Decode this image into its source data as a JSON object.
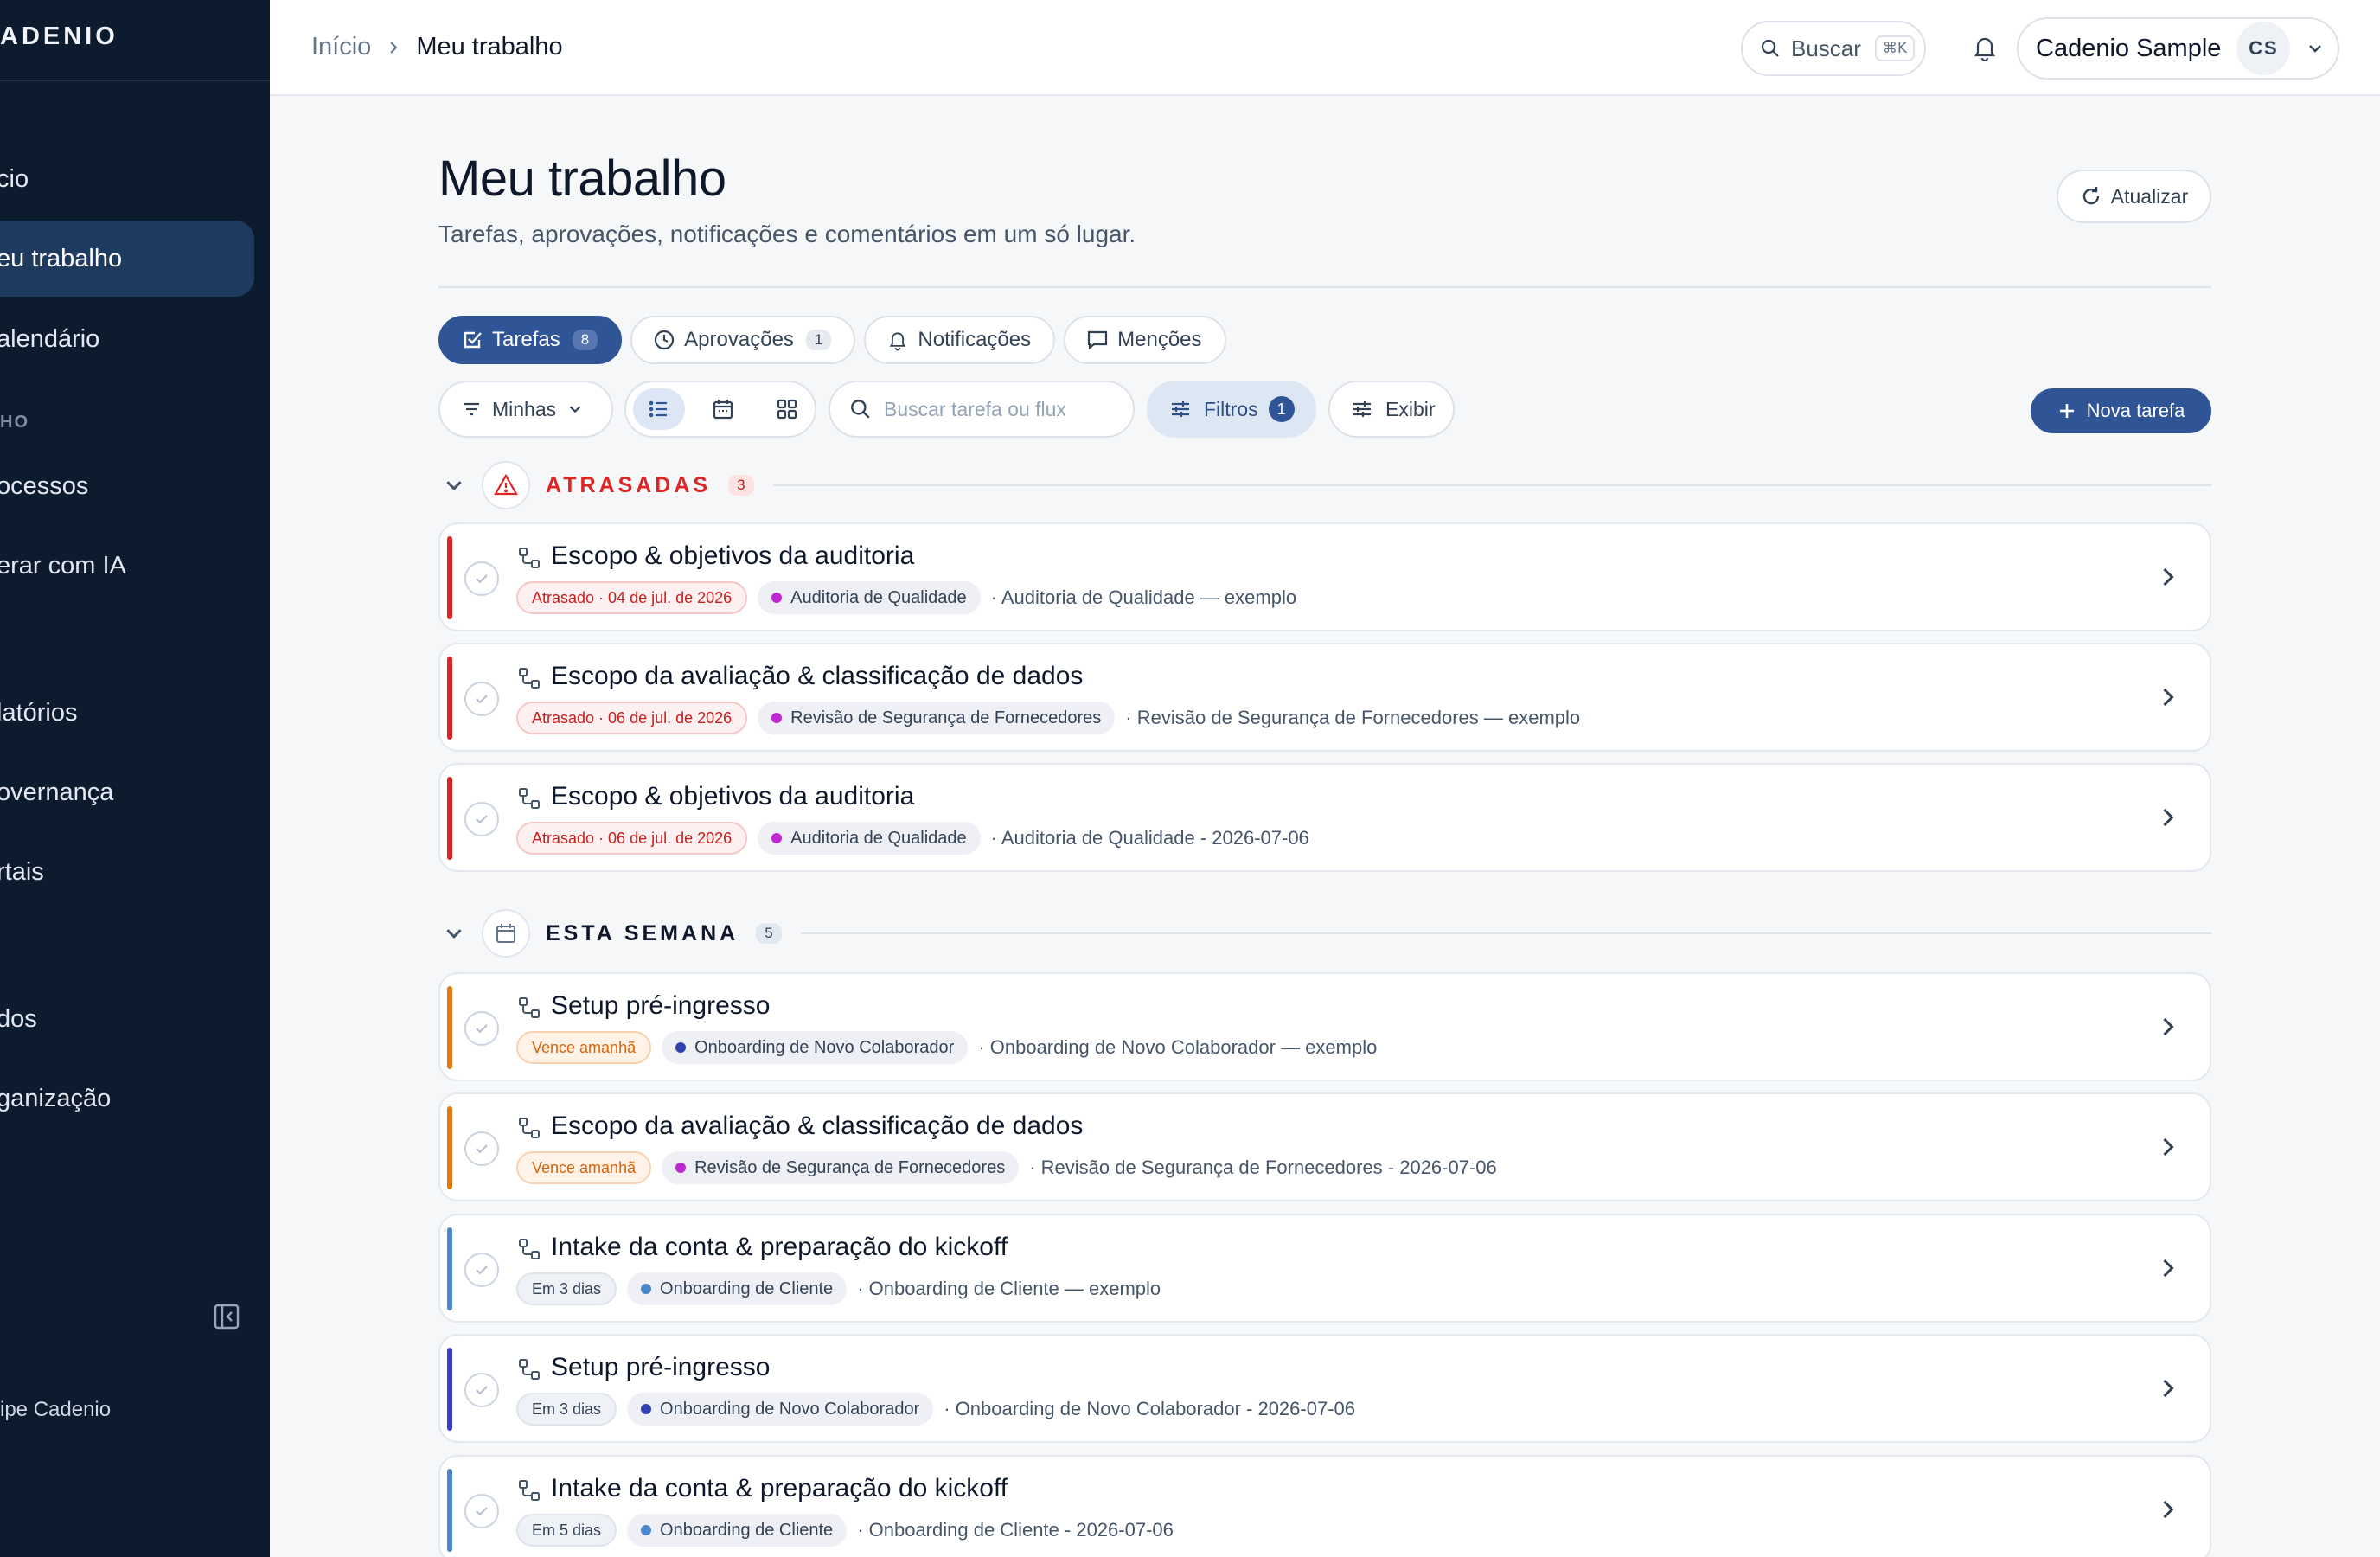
{
  "sidebar": {
    "brand": "ADENIO",
    "items": [
      {
        "label": "cio",
        "active": false
      },
      {
        "label": "eu trabalho",
        "active": true
      },
      {
        "label": "alendário",
        "active": false
      }
    ],
    "section1": "HO",
    "items2": [
      {
        "label": "ocessos"
      },
      {
        "label": "erar com IA"
      }
    ],
    "section2": "",
    "items3": [
      {
        "label": "latórios"
      },
      {
        "label": "overnança"
      },
      {
        "label": "rtais"
      }
    ],
    "items4": [
      {
        "label": "dos"
      },
      {
        "label": "ganização"
      }
    ],
    "footer": "ipe Cadenio",
    "collapse_icon": "sidebar-collapse-icon"
  },
  "topbar": {
    "breadcrumb_home": "Início",
    "breadcrumb_current": "Meu trabalho",
    "search_label": "Buscar",
    "search_shortcut": "⌘K",
    "user_name": "Cadenio Sample",
    "user_initials": "CS"
  },
  "page": {
    "title": "Meu trabalho",
    "subtitle": "Tarefas, aprovações, notificações e comentários em um só lugar.",
    "refresh_label": "Atualizar"
  },
  "tabs": [
    {
      "label": "Tarefas",
      "count": "8",
      "icon": "checkbox-icon",
      "active": true
    },
    {
      "label": "Aprovações",
      "count": "1",
      "icon": "clock-icon",
      "active": false
    },
    {
      "label": "Notificações",
      "count": "",
      "icon": "bell-icon",
      "active": false
    },
    {
      "label": "Menções",
      "count": "",
      "icon": "comment-icon",
      "active": false
    }
  ],
  "toolbar": {
    "scope_label": "Minhas",
    "active_view": "list",
    "search_placeholder": "Buscar tarefa ou fluxo",
    "filters_label": "Filtros",
    "filters_count": "1",
    "display_label": "Exibir",
    "new_task_label": "Nova tarefa"
  },
  "groups": {
    "late": {
      "label": "ATRASADAS",
      "count": "3"
    },
    "week": {
      "label": "ESTA SEMANA",
      "count": "5"
    }
  },
  "colors": {
    "accent": "#2f5597",
    "late": "#dc2626",
    "soon": "#e07a10",
    "blue": "#4a86c8",
    "indigo": "#3b3fc4",
    "magenta": "#c026d3",
    "navy_dot": "#3142b0",
    "blue_dot": "#4a86c8"
  },
  "tasks": [
    {
      "title": "Escopo & objetivos da auditoria",
      "due": "Atrasado · 04 de jul. de 2026",
      "due_kind": "late",
      "process": "Auditoria de Qualidade",
      "dot": "#c026d3",
      "bar": "#dc2626",
      "source": "· Auditoria de Qualidade — exemplo"
    },
    {
      "title": "Escopo da avaliação & classificação de dados",
      "due": "Atrasado · 06 de jul. de 2026",
      "due_kind": "late",
      "process": "Revisão de Segurança de Fornecedores",
      "dot": "#c026d3",
      "bar": "#dc2626",
      "source": "· Revisão de Segurança de Fornecedores — exemplo"
    },
    {
      "title": "Escopo & objetivos da auditoria",
      "due": "Atrasado · 06 de jul. de 2026",
      "due_kind": "late",
      "process": "Auditoria de Qualidade",
      "dot": "#c026d3",
      "bar": "#dc2626",
      "source": "· Auditoria de Qualidade - 2026-07-06"
    },
    {
      "title": "Setup pré-ingresso",
      "due": "Vence amanhã",
      "due_kind": "soon",
      "process": "Onboarding de Novo Colaborador",
      "dot": "#3142b0",
      "bar": "#e07a10",
      "source": "· Onboarding de Novo Colaborador — exemplo"
    },
    {
      "title": "Escopo da avaliação & classificação de dados",
      "due": "Vence amanhã",
      "due_kind": "soon",
      "process": "Revisão de Segurança de Fornecedores",
      "dot": "#c026d3",
      "bar": "#e07a10",
      "source": "· Revisão de Segurança de Fornecedores - 2026-07-06"
    },
    {
      "title": "Intake da conta & preparação do kickoff",
      "due": "Em 3 dias",
      "due_kind": "days",
      "process": "Onboarding de Cliente",
      "dot": "#4a86c8",
      "bar": "#4a86c8",
      "source": "· Onboarding de Cliente — exemplo"
    },
    {
      "title": "Setup pré-ingresso",
      "due": "Em 3 dias",
      "due_kind": "days",
      "process": "Onboarding de Novo Colaborador",
      "dot": "#3142b0",
      "bar": "#3b3fc4",
      "source": "· Onboarding de Novo Colaborador - 2026-07-06"
    },
    {
      "title": "Intake da conta & preparação do kickoff",
      "due": "Em 5 dias",
      "due_kind": "days",
      "process": "Onboarding de Cliente",
      "dot": "#4a86c8",
      "bar": "#4a86c8",
      "source": "· Onboarding de Cliente - 2026-07-06"
    }
  ]
}
